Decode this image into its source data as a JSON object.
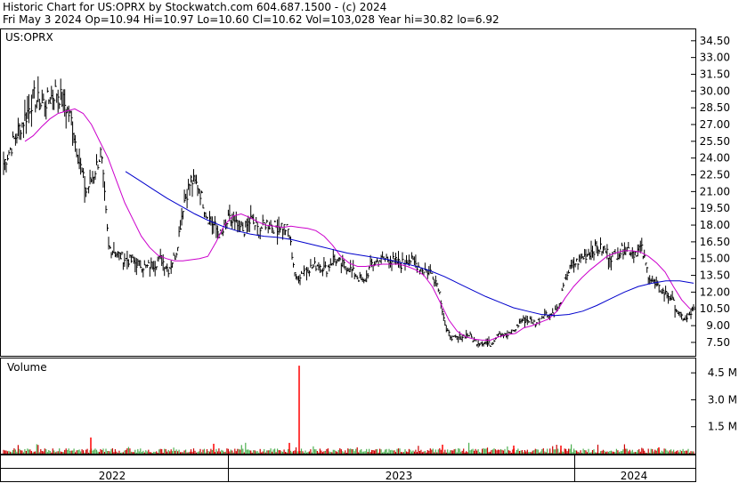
{
  "header": {
    "line1": "Historic Chart for US:OPRX by Stockwatch.com 604.687.1500 - (c) 2024",
    "line2": "Fri May  3 2024   Op=10.94   Hi=10.97   Lo=10.60   Cl=10.62   Vol=103,028   Year hi=30.82   lo=6.92"
  },
  "chart_data": {
    "type": "line",
    "symbol": "US:OPRX",
    "volume_label": "Volume",
    "price_ticks": [
      "34.50",
      "33.00",
      "31.50",
      "30.00",
      "28.50",
      "27.00",
      "25.50",
      "24.00",
      "22.50",
      "21.00",
      "19.50",
      "18.00",
      "16.50",
      "15.00",
      "13.50",
      "12.00",
      "10.50",
      "9.00",
      "7.50"
    ],
    "volume_ticks": [
      "4.5 M",
      "3.0 M",
      "1.5 M"
    ],
    "years": [
      "2022",
      "2023",
      "2024"
    ],
    "ylim": [
      6.3,
      35.6
    ],
    "colors": {
      "bar": "#000000",
      "ma_short": "#cc00cc",
      "ma_long": "#0000cc",
      "vol_up": "#4caf50",
      "vol_down": "#cc0000",
      "vol_spike": "#ff0000"
    },
    "series": [
      {
        "values": [
          23.5,
          25.0,
          26.5,
          27.8,
          29.5,
          28.8,
          29.2,
          30.0,
          29.0,
          27.5,
          24.0,
          21.0,
          22.5,
          24.5,
          16.0,
          15.5,
          15.0,
          14.8,
          14.5,
          14.2,
          14.5,
          15.0,
          14.0,
          15.5,
          20.0,
          22.0,
          21.5,
          19.0,
          18.0,
          17.0,
          18.5,
          18.0,
          17.5,
          18.5,
          17.5,
          18.2,
          17.8,
          18.0,
          17.5,
          13.0,
          14.0,
          14.2,
          14.5,
          14.0,
          15.0,
          14.5,
          14.2,
          13.5,
          12.8,
          14.5,
          14.8,
          15.0,
          14.8,
          14.5,
          15.0,
          14.5,
          14.0,
          13.8,
          12.5,
          8.5,
          7.8,
          8.0,
          8.2,
          7.5,
          7.5,
          7.3,
          8.5,
          8.0,
          8.5,
          9.5,
          9.5,
          9.2,
          10.0,
          10.0,
          10.5,
          13.5,
          14.5,
          15.0,
          15.5,
          16.0,
          15.8,
          15.2,
          15.5,
          16.0,
          15.5,
          16.0,
          13.5,
          12.5,
          12.0,
          11.5,
          10.0,
          9.5,
          10.5
        ]
      },
      {
        "values": [
          25.5,
          26.0,
          26.8,
          27.5,
          28.0,
          28.2,
          28.4,
          28.0,
          27.0,
          25.5,
          24.0,
          22.0,
          20.0,
          18.5,
          17.0,
          16.0,
          15.3,
          15.0,
          14.8,
          14.8,
          14.9,
          15.0,
          15.2,
          16.5,
          18.0,
          18.8,
          19.0,
          18.7,
          18.3,
          18.0,
          17.9,
          17.8,
          17.9,
          17.8,
          17.7,
          17.5,
          17.0,
          16.2,
          15.2,
          14.6,
          14.3,
          14.3,
          14.4,
          14.5,
          14.5,
          14.5,
          14.3,
          14.0,
          13.5,
          12.5,
          11.0,
          9.5,
          8.5,
          8.0,
          7.8,
          7.7,
          7.7,
          8.0,
          8.2,
          8.3,
          8.8,
          9.0,
          9.3,
          9.6,
          10.3,
          11.5,
          12.5,
          13.3,
          14.0,
          14.6,
          15.2,
          15.5,
          15.7,
          15.7,
          15.6,
          15.2,
          14.6,
          13.8,
          12.5,
          11.3,
          10.5
        ]
      },
      {
        "values": [
          22.8,
          22.0,
          21.2,
          20.4,
          19.7,
          19.0,
          18.4,
          17.9,
          17.5,
          17.2,
          17.0,
          16.9,
          16.7,
          16.4,
          16.1,
          15.8,
          15.5,
          15.3,
          15.1,
          14.9,
          14.6,
          14.3,
          13.9,
          13.4,
          12.8,
          12.2,
          11.6,
          11.1,
          10.6,
          10.3,
          10.0,
          9.9,
          10.0,
          10.3,
          10.8,
          11.4,
          12.0,
          12.5,
          12.8,
          13.0,
          13.0,
          12.8
        ]
      }
    ]
  }
}
